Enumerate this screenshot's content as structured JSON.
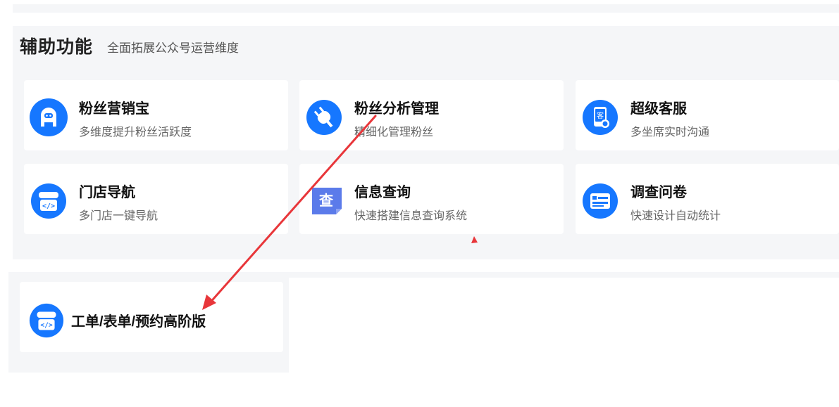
{
  "section": {
    "title": "辅助功能",
    "subtitle": "全面拓展公众号运营维度",
    "cards": [
      {
        "title": "粉丝营销宝",
        "desc": "多维度提升粉丝活跃度",
        "icon": "robot-face-icon"
      },
      {
        "title": "粉丝分析管理",
        "desc": "精细化管理粉丝",
        "icon": "plug-icon"
      },
      {
        "title": "超级客服",
        "desc": "多坐席实时沟通",
        "icon": "customer-service-phone-icon"
      },
      {
        "title": "门店导航",
        "desc": "多门店一键导航",
        "icon": "store-code-icon"
      },
      {
        "title": "信息查询",
        "desc": "快速搭建信息查询系统",
        "icon": "query-icon",
        "icon_text": "查"
      },
      {
        "title": "调查问卷",
        "desc": "快速设计自动统计",
        "icon": "survey-form-icon"
      }
    ]
  },
  "section2": {
    "card": {
      "title": "工单/表单/预约高阶版",
      "icon": "store-code-icon"
    }
  },
  "annotation": {
    "arrow_color": "#e8363a"
  },
  "colors": {
    "accent": "#1677ff",
    "panel_bg": "#f5f6f8",
    "query_icon": "#5b7bea"
  }
}
